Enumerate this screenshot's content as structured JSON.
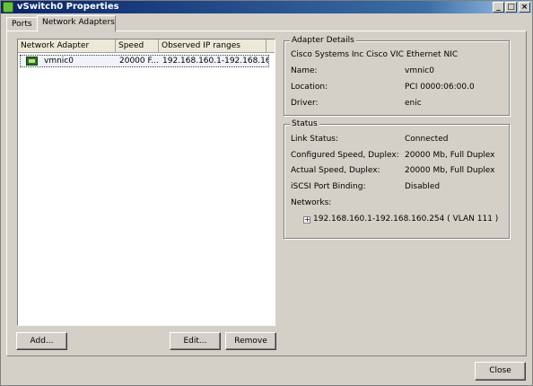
{
  "window": {
    "title": "vSwitch0 Properties"
  },
  "tabs": [
    {
      "label": "Ports"
    },
    {
      "label": "Network Adapters"
    }
  ],
  "adapters_list": {
    "columns": [
      "Network Adapter",
      "Speed",
      "Observed IP ranges"
    ],
    "rows": [
      {
        "adapter": "vmnic0",
        "speed": "20000 F...",
        "ip_ranges": "192.168.160.1-192.168.160..."
      }
    ]
  },
  "buttons": {
    "add": "Add...",
    "edit": "Edit...",
    "remove": "Remove",
    "close": "Close"
  },
  "adapter_details": {
    "title": "Adapter Details",
    "description": "Cisco Systems Inc Cisco VIC Ethernet NIC",
    "fields": [
      {
        "label": "Name:",
        "value": "vmnic0"
      },
      {
        "label": "Location:",
        "value": "PCI 0000:06:00.0"
      },
      {
        "label": "Driver:",
        "value": "enic"
      }
    ]
  },
  "status": {
    "title": "Status",
    "fields": [
      {
        "label": "Link Status:",
        "value": "Connected"
      },
      {
        "label": "Configured Speed, Duplex:",
        "value": "20000 Mb, Full Duplex"
      },
      {
        "label": "Actual Speed, Duplex:",
        "value": "20000 Mb, Full Duplex"
      },
      {
        "label": "iSCSI Port Binding:",
        "value": "Disabled"
      },
      {
        "label": "Networks:",
        "value": ""
      }
    ],
    "networks": [
      "192.168.160.1-192.168.160.254 ( VLAN 111 )"
    ]
  }
}
